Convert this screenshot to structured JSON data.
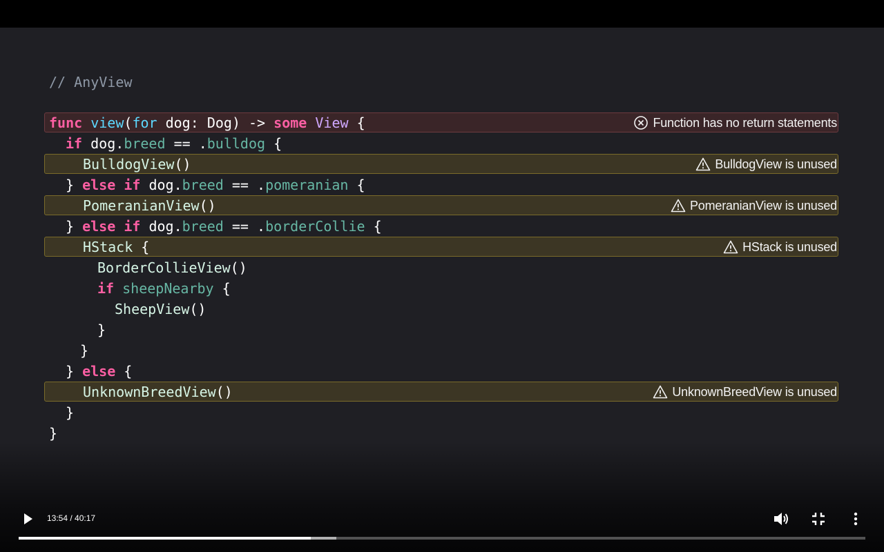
{
  "code": {
    "comment": "// AnyView",
    "lines": [
      {
        "tokens": [
          {
            "t": "func",
            "c": "kw"
          },
          {
            "t": " ",
            "c": "pl"
          },
          {
            "t": "view",
            "c": "fnb"
          },
          {
            "t": "(",
            "c": "pl"
          },
          {
            "t": "for",
            "c": "fnb"
          },
          {
            "t": " dog: ",
            "c": "pl"
          },
          {
            "t": "Dog",
            "c": "pl"
          },
          {
            "t": ") -> ",
            "c": "pl"
          },
          {
            "t": "some",
            "c": "kw"
          },
          {
            "t": " ",
            "c": "pl"
          },
          {
            "t": "View",
            "c": "typ"
          },
          {
            "t": " {",
            "c": "pl"
          }
        ],
        "highlight": "error",
        "message": "Function has no return statements",
        "icon": "error-circle-x-icon"
      },
      {
        "tokens": [
          {
            "t": "if",
            "c": "kw"
          },
          {
            "t": " dog.",
            "c": "pl"
          },
          {
            "t": "breed",
            "c": "prop"
          },
          {
            "t": " == .",
            "c": "pl"
          },
          {
            "t": "bulldog",
            "c": "prop"
          },
          {
            "t": " {",
            "c": "pl"
          }
        ]
      },
      {
        "tokens": [
          {
            "t": "BulldogView",
            "c": "call"
          },
          {
            "t": "()",
            "c": "pl"
          }
        ],
        "highlight": "warn",
        "message": "BulldogView is unused",
        "icon": "warning-triangle-icon"
      },
      {
        "tokens": [
          {
            "t": "} ",
            "c": "pl"
          },
          {
            "t": "else",
            "c": "kw"
          },
          {
            "t": " ",
            "c": "pl"
          },
          {
            "t": "if",
            "c": "kw"
          },
          {
            "t": " dog.",
            "c": "pl"
          },
          {
            "t": "breed",
            "c": "prop"
          },
          {
            "t": " == .",
            "c": "pl"
          },
          {
            "t": "pomeranian",
            "c": "prop"
          },
          {
            "t": " {",
            "c": "pl"
          }
        ]
      },
      {
        "tokens": [
          {
            "t": "PomeranianView",
            "c": "call"
          },
          {
            "t": "()",
            "c": "pl"
          }
        ],
        "highlight": "warn",
        "message": "PomeranianView is unused",
        "icon": "warning-triangle-icon"
      },
      {
        "tokens": [
          {
            "t": "} ",
            "c": "pl"
          },
          {
            "t": "else",
            "c": "kw"
          },
          {
            "t": " ",
            "c": "pl"
          },
          {
            "t": "if",
            "c": "kw"
          },
          {
            "t": " dog.",
            "c": "pl"
          },
          {
            "t": "breed",
            "c": "prop"
          },
          {
            "t": " == .",
            "c": "pl"
          },
          {
            "t": "borderCollie",
            "c": "prop"
          },
          {
            "t": " {",
            "c": "pl"
          }
        ]
      },
      {
        "tokens": [
          {
            "t": "HStack",
            "c": "call"
          },
          {
            "t": " {",
            "c": "pl"
          }
        ],
        "highlight": "warn",
        "message": "HStack is unused",
        "icon": "warning-triangle-icon"
      },
      {
        "tokens": [
          {
            "t": "BorderCollieView",
            "c": "call"
          },
          {
            "t": "()",
            "c": "pl"
          }
        ]
      },
      {
        "tokens": [
          {
            "t": "if",
            "c": "kw"
          },
          {
            "t": " ",
            "c": "pl"
          },
          {
            "t": "sheepNearby",
            "c": "prop"
          },
          {
            "t": " {",
            "c": "pl"
          }
        ]
      },
      {
        "tokens": [
          {
            "t": "SheepView",
            "c": "call"
          },
          {
            "t": "()",
            "c": "pl"
          }
        ]
      },
      {
        "tokens": [
          {
            "t": "}",
            "c": "pl"
          }
        ]
      },
      {
        "tokens": [
          {
            "t": "}",
            "c": "pl"
          }
        ]
      },
      {
        "tokens": [
          {
            "t": "} ",
            "c": "pl"
          },
          {
            "t": "else",
            "c": "kw"
          },
          {
            "t": " {",
            "c": "pl"
          }
        ]
      },
      {
        "tokens": [
          {
            "t": "UnknownBreedView",
            "c": "call"
          },
          {
            "t": "()",
            "c": "pl"
          }
        ],
        "highlight": "warn",
        "message": "UnknownBreedView is unused",
        "icon": "warning-triangle-icon"
      },
      {
        "tokens": [
          {
            "t": "}",
            "c": "pl"
          }
        ]
      },
      {
        "tokens": [
          {
            "t": "}",
            "c": "pl"
          }
        ]
      }
    ]
  },
  "player": {
    "current_time": "13:54",
    "duration": "40:17",
    "time_display": "13:54 / 40:17",
    "played_fraction": 0.345,
    "buffered_fraction": 0.375,
    "play_icon": "play-icon",
    "volume_icon": "volume-icon",
    "exit_fullscreen_icon": "exit-fullscreen-icon",
    "more_icon": "more-vertical-icon"
  },
  "colors": {
    "keyword": "#fc5fa3",
    "type": "#d0a8ff",
    "function_name": "#5dd8ff",
    "property": "#67b7a4",
    "error_highlight": "#3a2528",
    "warning_highlight": "#3c3624",
    "background": "#1f1f24"
  }
}
